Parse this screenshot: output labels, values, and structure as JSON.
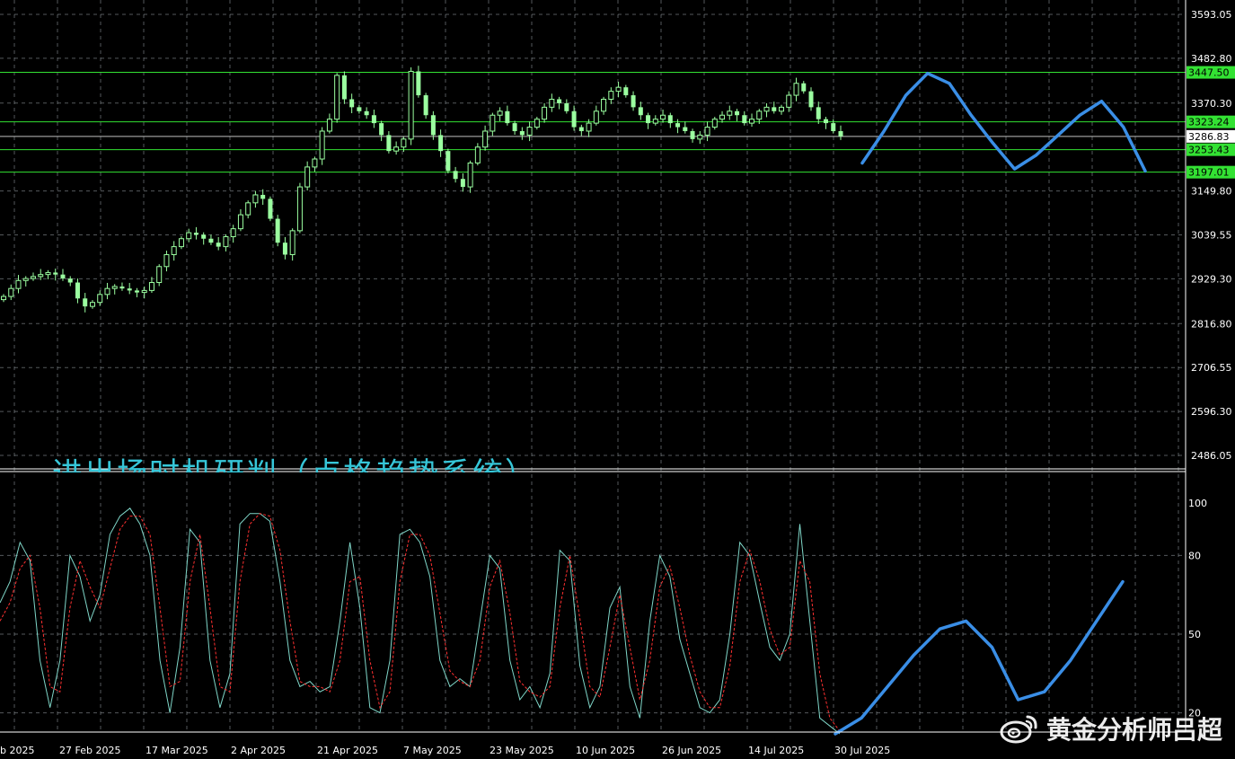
{
  "chart_data": [
    {
      "type": "candlestick",
      "y_axis_ticks": [
        "3593.05",
        "3482.80",
        "3370.30",
        "3149.80",
        "3039.55",
        "2929.30",
        "2816.80",
        "2706.55",
        "2596.30",
        "2486.05"
      ],
      "ylim": [
        2486.05,
        3593.05
      ],
      "x_axis_ticks": [
        "b 2025",
        "27 Feb 2025",
        "17 Mar 2025",
        "2 Apr 2025",
        "21 Apr 2025",
        "7 May 2025",
        "23 May 2025",
        "10 Jun 2025",
        "26 Jun 2025",
        "14 Jul 2025",
        "30 Jul 2025"
      ],
      "grid": true,
      "current_price": "3286.83",
      "levels": [
        {
          "label": "3447.50",
          "value": 3447.5
        },
        {
          "label": "3323.24",
          "value": 3323.24
        },
        {
          "label": "3253.43",
          "value": 3253.43
        },
        {
          "label": "3197.01",
          "value": 3197.01
        }
      ],
      "closes": [
        2885,
        2905,
        2925,
        2930,
        2935,
        2940,
        2945,
        2940,
        2930,
        2920,
        2880,
        2860,
        2870,
        2890,
        2905,
        2910,
        2905,
        2900,
        2895,
        2900,
        2920,
        2960,
        2990,
        3010,
        3030,
        3045,
        3040,
        3030,
        3020,
        3010,
        3035,
        3055,
        3090,
        3120,
        3140,
        3130,
        3080,
        3020,
        2990,
        3050,
        3160,
        3210,
        3230,
        3300,
        3330,
        3440,
        3380,
        3360,
        3350,
        3340,
        3320,
        3290,
        3250,
        3260,
        3280,
        3450,
        3390,
        3340,
        3290,
        3250,
        3200,
        3180,
        3160,
        3220,
        3260,
        3300,
        3340,
        3350,
        3320,
        3300,
        3290,
        3310,
        3330,
        3360,
        3380,
        3370,
        3350,
        3310,
        3300,
        3320,
        3350,
        3380,
        3400,
        3410,
        3390,
        3360,
        3340,
        3320,
        3330,
        3340,
        3320,
        3310,
        3300,
        3280,
        3290,
        3310,
        3330,
        3340,
        3350,
        3340,
        3320,
        3330,
        3350,
        3360,
        3350,
        3360,
        3390,
        3420,
        3400,
        3360,
        3330,
        3320,
        3300,
        3286.83
      ],
      "forecast_path": [
        3220,
        3300,
        3390,
        3445,
        3420,
        3340,
        3270,
        3205,
        3240,
        3290,
        3340,
        3375,
        3310,
        3200
      ]
    },
    {
      "type": "line",
      "y_axis_ticks": [
        "100",
        "80",
        "50",
        "20"
      ],
      "ylim": [
        0,
        100
      ],
      "x_axis_ticks": [
        "b 2025",
        "27 Feb 2025",
        "17 Mar 2025",
        "2 Apr 2025",
        "21 Apr 2025",
        "7 May 2025",
        "23 May 2025",
        "10 Jun 2025",
        "26 Jun 2025",
        "14 Jul 2025",
        "30 Jul 2025"
      ],
      "grid": true,
      "series": [
        {
          "values": [
            62,
            70,
            85,
            78,
            40,
            22,
            40,
            80,
            72,
            55,
            65,
            88,
            95,
            98,
            92,
            80,
            40,
            20,
            45,
            90,
            85,
            40,
            22,
            35,
            92,
            96,
            96,
            93,
            70,
            40,
            30,
            32,
            28,
            30,
            55,
            85,
            60,
            22,
            20,
            40,
            88,
            90,
            85,
            72,
            40,
            30,
            33,
            30,
            55,
            80,
            75,
            40,
            25,
            30,
            22,
            35,
            82,
            78,
            38,
            22,
            30,
            60,
            68,
            30,
            18,
            55,
            80,
            72,
            48,
            35,
            22,
            20,
            25,
            50,
            85,
            80,
            62,
            45,
            40,
            50,
            92,
            55,
            18,
            15,
            12
          ]
        },
        {
          "values": [
            55,
            62,
            75,
            80,
            60,
            30,
            28,
            60,
            78,
            68,
            60,
            75,
            90,
            95,
            95,
            88,
            60,
            30,
            32,
            70,
            88,
            60,
            30,
            28,
            70,
            92,
            96,
            95,
            82,
            55,
            32,
            30,
            30,
            28,
            40,
            70,
            72,
            40,
            22,
            28,
            70,
            88,
            88,
            80,
            58,
            36,
            32,
            30,
            40,
            68,
            78,
            58,
            32,
            28,
            26,
            30,
            60,
            80,
            56,
            30,
            26,
            45,
            65,
            45,
            25,
            40,
            68,
            76,
            60,
            42,
            28,
            22,
            22,
            38,
            70,
            82,
            70,
            52,
            42,
            45,
            78,
            70,
            35,
            18,
            13
          ]
        }
      ],
      "forecast_path": [
        12,
        18,
        30,
        42,
        52,
        55,
        45,
        25,
        28,
        40,
        55,
        70
      ]
    }
  ],
  "overlay_text": "进出场时机研判（点格趋势系统）",
  "watermark_text": "黄金分析师吕超",
  "colors": {
    "background": "#000000",
    "candle": "#9bffa0",
    "level_line": "#33e233",
    "forecast": "#3a8ee6",
    "stoch_main": "#7fd6c8",
    "stoch_signal": "#ff3030"
  }
}
